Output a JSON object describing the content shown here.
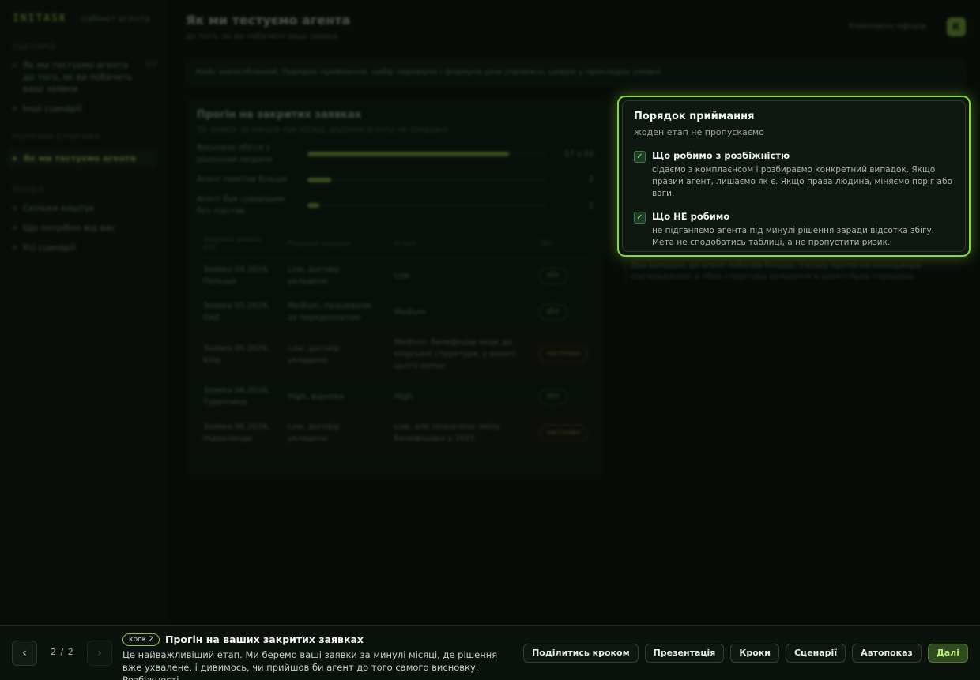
{
  "app": {
    "brand": "INITASK",
    "brand_sub": "кабінет агента"
  },
  "sidebar": {
    "section1": "сценарій",
    "items1": [
      {
        "label": "Як ми тестуємо агента до того, як ви побачить ваші заявки",
        "count": "2/2"
      },
      {
        "label": "Інші сценарії"
      }
    ],
    "section2": "поточна сторінка",
    "active_item": "Як ми тестуємо агента",
    "section3": "розділ",
    "items3": [
      {
        "label": "Скільки коштує"
      },
      {
        "label": "Що потрібно від вас"
      },
      {
        "label": "Усі сценарії"
      }
    ]
  },
  "header": {
    "title": "Як ми тестуємо агента",
    "subtitle": "до того, як ви побачите ваші заявки",
    "role": "Комплаєнс-офіцер",
    "avatar_letter": "К"
  },
  "notice": "Кейс знеособлений. Порядок приймання, набір перевірок і формула ціни справжні, цифри у прикладах умовні.",
  "card": {
    "title": "Прогін на закритих заявках",
    "subtitle": "35 заявок за минулі три місяці, рішення агенту не показане",
    "metrics": [
      {
        "label": "Висновок збігся з рішенням людини",
        "fraction": 0.85,
        "value": "17 з 20"
      },
      {
        "label": "Агент помітив більше",
        "fraction": 0.1,
        "value": "2"
      },
      {
        "label": "Агент був суворішим без підстав",
        "fraction": 0.05,
        "value": "1"
      }
    ],
    "table": {
      "headers": [
        "Закрита заявка KYC",
        "Рішення людини",
        "Агент",
        "Збіг"
      ],
      "rows": [
        {
          "case": "Заявка 04.2026, Польща",
          "human": "Low, договір укладено",
          "agent": "Low",
          "match": "збіг",
          "status": "ok"
        },
        {
          "case": "Заявка 05.2026, ОАЕ",
          "human": "Medium, працювали за передоплатою",
          "agent": "Medium",
          "match": "збіг",
          "status": "ok"
        },
        {
          "case": "Заявка 05.2026, Кіпр",
          "human": "Low, договір укладено",
          "agent": "Medium: бенефіціар веде до кіпрської структури, у анкеті цього немає",
          "match": "частково",
          "status": "warn"
        },
        {
          "case": "Заявка 06.2026, Туреччина",
          "human": "High, відмова",
          "agent": "High",
          "match": "збіг",
          "status": "ok"
        },
        {
          "case": "Заявка 06.2026, Нідерланди",
          "human": "Low, договір укладено",
          "agent": "Low, але позначено зміну бенефіціара у 2025",
          "match": "частково",
          "status": "warn"
        }
      ]
    }
  },
  "under_text": "Два випадки, де агент побачив більше, з'ясову протягом менеджера підтверджено: в обох структура володіння в анкеті була спрощена.",
  "popup": {
    "title": "Порядок приймання",
    "subtitle": "жоден етап не пропускаємо",
    "items": [
      {
        "title": "Що робимо з розбіжністю",
        "desc": "сідаємо з комплаєнсом і розбираємо конкретний випадок. Якщо правий агент, лишаємо як є. Якщо права людина, міняємо поріг або ваги."
      },
      {
        "title": "Що НЕ робимо",
        "desc": "не підганяємо агента під минулі рішення заради відсотка збігу. Мета не сподобатись таблиці, а не пропустити ризик."
      }
    ]
  },
  "bottombar": {
    "page_current": "2",
    "page_total": "2",
    "step_badge": "крок 2",
    "step_title": "Прогін на ваших закритих заявках",
    "step_desc": "Це найважливіший етап. Ми беремо ваші заявки за минулі місяці, де рішення вже ухвалене, і дивимось, чи прийшов би агент до того самого висновку. Розбіжності…",
    "actions": {
      "share": "Поділитись кроком",
      "presentation": "Презентація",
      "steps": "Кроки",
      "scenarios": "Сценарії",
      "autoplay": "Автопоказ",
      "next": "Далі"
    }
  }
}
